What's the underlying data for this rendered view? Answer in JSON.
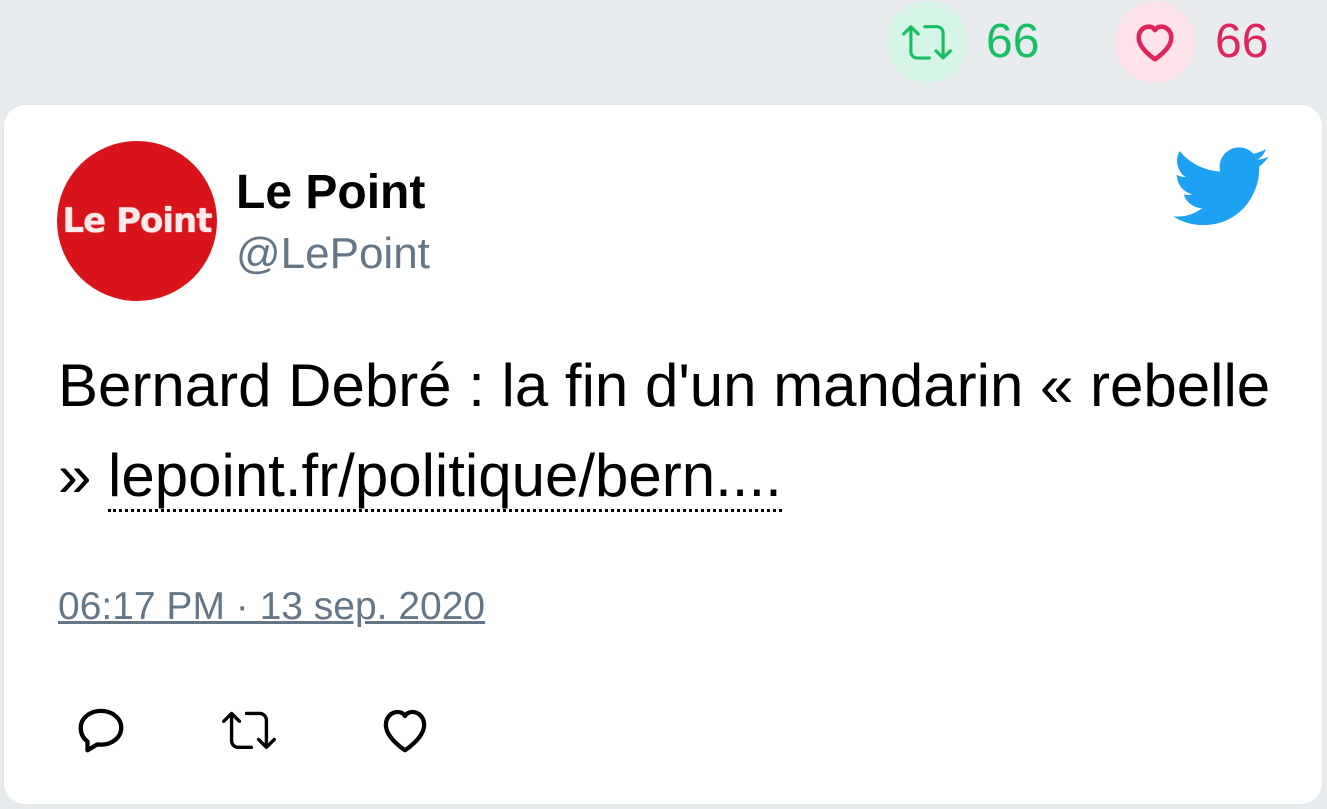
{
  "stats": {
    "retweet_count": "66",
    "like_count": "66",
    "retweet_color": "#17bf63",
    "like_color": "#e0245e"
  },
  "tweet": {
    "author_name": "Le Point",
    "author_handle": "@LePoint",
    "avatar_text": "Le Point",
    "text_prefix": "Bernard Debré : la fin d'un mandarin « rebelle » ",
    "link_text": "lepoint.fr/politique/bern....",
    "timestamp": "06:17 PM · 13 sep. 2020"
  },
  "icons": {
    "brand": "twitter-bird-icon",
    "actions": [
      "reply-icon",
      "retweet-icon",
      "like-icon"
    ]
  }
}
